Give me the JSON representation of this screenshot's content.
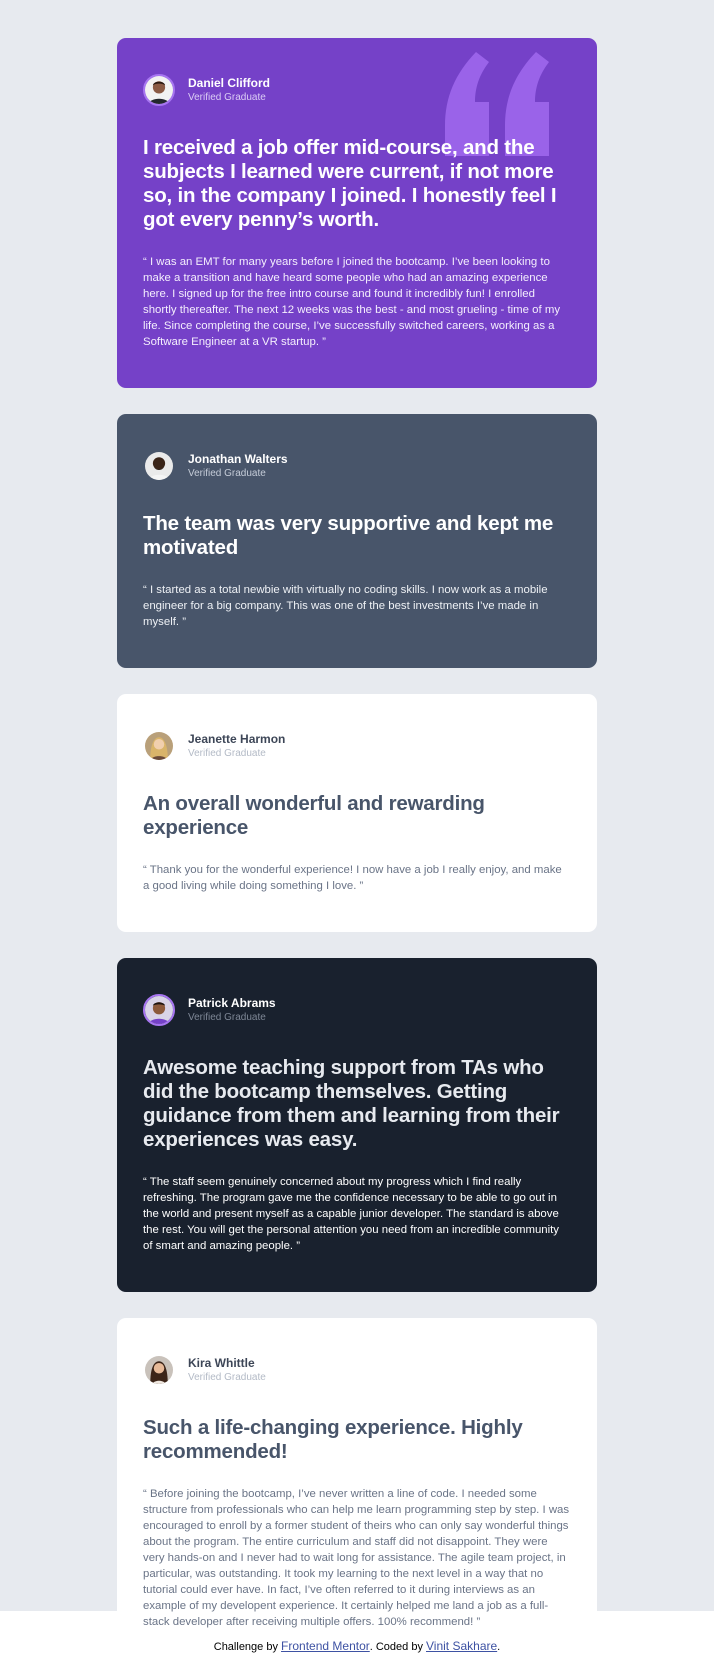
{
  "colors": {
    "page_bg": "#e7eaef",
    "purple": "#7541c8",
    "slate": "#48556a",
    "white": "#ffffff",
    "dark": "#19212e",
    "accent_violet": "#a775f1",
    "link": "#3e52a3"
  },
  "testimonials": [
    {
      "name": "Daniel Clifford",
      "role": "Verified Graduate",
      "headline": "I received a job offer mid-course, and the subjects I learned were current, if not more so, in the company I joined. I honestly feel I got every penny’s worth.",
      "quote": "“ I was an EMT for many years before I joined the bootcamp. I’ve been looking to make a transition and have heard some people who had an amazing experience here. I signed up for the free intro course and found it incredibly fun! I enrolled shortly thereafter. The next 12 weeks was the best - and most grueling - time of my life. Since completing the course, I’ve successfully switched careers, working as a Software Engineer at a VR startup. ”",
      "decoration_icon": "quotation-mark-icon"
    },
    {
      "name": "Jonathan Walters",
      "role": "Verified Graduate",
      "headline": "The team was very supportive and kept me motivated",
      "quote": "“ I started as a total newbie with virtually no coding skills. I now work as a mobile engineer for a big company. This was one of the best investments I’ve made in myself. ”"
    },
    {
      "name": "Jeanette Harmon",
      "role": "Verified Graduate",
      "headline": "An overall wonderful and rewarding experience",
      "quote": "“ Thank you for the wonderful experience! I now have a job I really enjoy, and make a good living while doing something I love. ”"
    },
    {
      "name": "Patrick Abrams",
      "role": "Verified Graduate",
      "headline": "Awesome teaching support from TAs who did the bootcamp themselves. Getting guidance from them and learning from their experiences was easy.",
      "quote": "“ The staff seem genuinely concerned about my progress which I find really refreshing. The program gave me the confidence necessary to be able to go out in the world and present myself as a capable junior developer. The standard is above the rest. You will get the personal attention you need from an incredible community of smart and amazing people. ”"
    },
    {
      "name": "Kira Whittle",
      "role": "Verified Graduate",
      "headline": "Such a life-changing experience. Highly recommended!",
      "quote": "“ Before joining the bootcamp, I’ve never written a line of code. I needed some structure from professionals who can help me learn programming step by step. I was encouraged to enroll by a former student of theirs who can only say wonderful things about the program. The entire curriculum and staff did not disappoint. They were very hands-on and I never had to wait long for assistance. The agile team project, in particular, was outstanding. It took my learning to the next level in a way that no tutorial could ever have. In fact, I’ve often referred to it during interviews as an example of my developent experience. It certainly helped me land a job as a full-stack developer after receiving multiple offers. 100% recommend! ”"
    }
  ],
  "footer": {
    "prefix": "Challenge by ",
    "link1": "Frontend Mentor",
    "middle": ". Coded by ",
    "link2": "Vinit Sakhare",
    "suffix": "."
  }
}
